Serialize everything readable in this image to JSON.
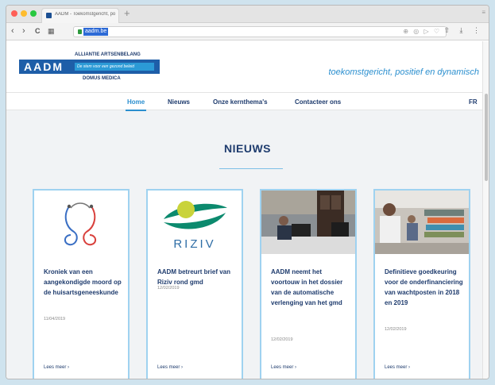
{
  "browser": {
    "tab_title": "AADM - Toekomstgericht, po",
    "new_tab": "+",
    "tab_menu": "≡",
    "back": "‹",
    "forward": "›",
    "reload": "C",
    "grid": "▦",
    "url": "aadm.be",
    "url_icons": "⊕ ◎ ▷ ♡",
    "toolbar_icons": "⇧ ⤓ ⋮"
  },
  "header": {
    "logo_top": "ALLIANTIE ARTSENBELANG",
    "logo_main": "AADM",
    "logo_slogan": "De stem voor een gezond beleid",
    "logo_bottom": "DOMUS MEDICA",
    "tagline": "toekomstgericht, positief en dynamisch"
  },
  "nav": {
    "items": [
      {
        "label": "Home"
      },
      {
        "label": "Nieuws"
      },
      {
        "label": "Onze kernthema's"
      },
      {
        "label": "Contacteer ons"
      }
    ],
    "language": "FR"
  },
  "section": {
    "title": "NIEUWS"
  },
  "cards": [
    {
      "title": "Kroniek van een aangekondigde moord op de huisartsgeneeskunde",
      "date": "11/04/2019",
      "more": "Lees meer ›",
      "image": "stethoscope-image"
    },
    {
      "title": "AADM betreurt brief van Riziv rond gmd",
      "date": "12/02/2019",
      "more": "Lees meer ›",
      "image": "riziv-logo",
      "logo_text": "RIZIV"
    },
    {
      "title": "AADM neemt het voortouw in het dossier van de automatische verlenging van het gmd",
      "date": "12/02/2019",
      "more": "Lees meer ›",
      "image": "office-photo"
    },
    {
      "title": "Definitieve goedkeuring voor de onderfinanciering van wachtposten in 2018 en 2019",
      "date": "12/02/2019",
      "more": "Lees meer ›",
      "image": "desk-photo"
    }
  ],
  "colors": {
    "brand_navy": "#1f3c6e",
    "brand_blue": "#2b8fcf",
    "card_border": "#9fd2f0"
  }
}
